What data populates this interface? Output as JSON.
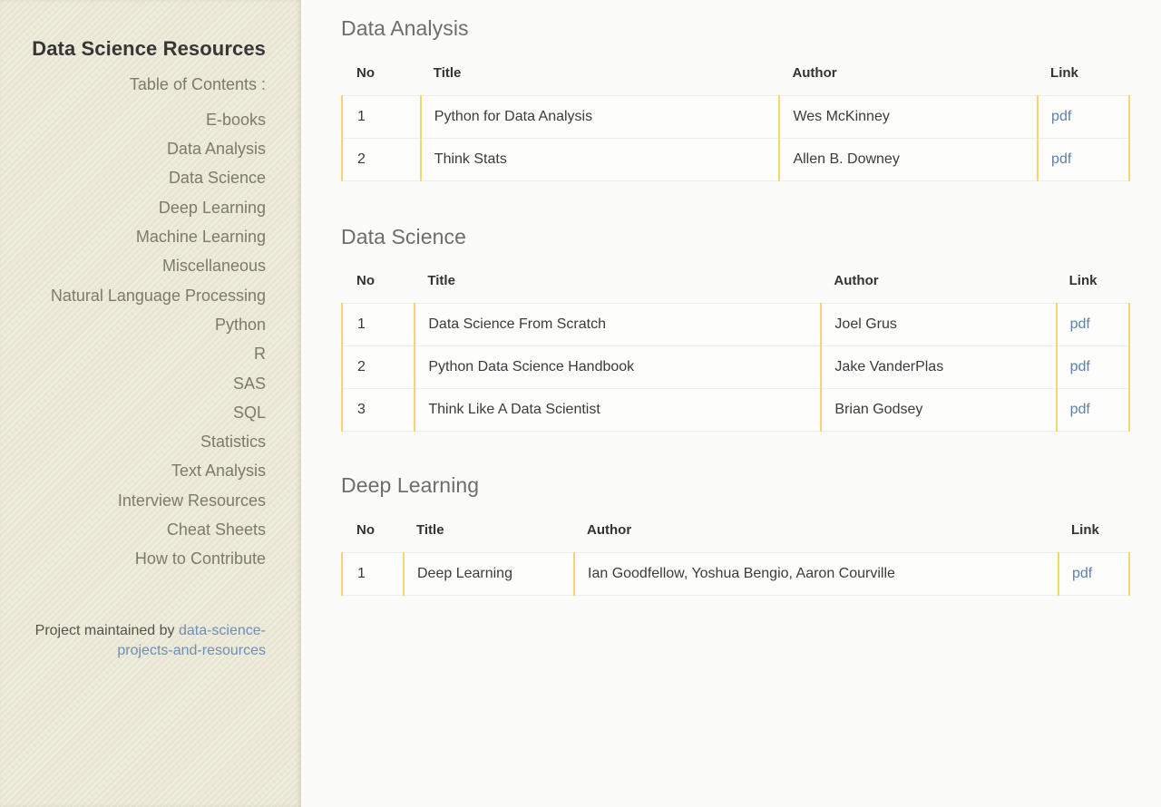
{
  "sidebar": {
    "title": "Data Science Resources",
    "toc_caption": "Table of Contents :",
    "items": [
      {
        "label": "E-books"
      },
      {
        "label": "Data Analysis"
      },
      {
        "label": "Data Science"
      },
      {
        "label": "Deep Learning"
      },
      {
        "label": "Machine Learning"
      },
      {
        "label": "Miscellaneous"
      },
      {
        "label": "Natural Language Processing"
      },
      {
        "label": "Python"
      },
      {
        "label": "R"
      },
      {
        "label": "SAS"
      },
      {
        "label": "SQL"
      },
      {
        "label": "Statistics"
      },
      {
        "label": "Text Analysis"
      },
      {
        "label": "Interview Resources"
      },
      {
        "label": "Cheat Sheets"
      },
      {
        "label": "How to Contribute"
      }
    ],
    "footer": {
      "prefix": "Project maintained by ",
      "link_label": "data-science-projects-and-resources"
    }
  },
  "colors": {
    "sidebar_bg": "#eae6d4",
    "content_bg": "#fbfbf9",
    "table_accent": "#f5d76e",
    "link": "#5b81ad",
    "heading": "#6d6d6d",
    "sidebar_text": "#7d7a6d"
  },
  "sections": [
    {
      "id": "data-analysis",
      "title": "Data Analysis",
      "columns": [
        "No",
        "Title",
        "Author",
        "Link"
      ],
      "rows": [
        {
          "no": "1",
          "title": "Python for Data Analysis",
          "author": "Wes McKinney",
          "link": "pdf"
        },
        {
          "no": "2",
          "title": "Think Stats",
          "author": "Allen B. Downey",
          "link": "pdf"
        }
      ]
    },
    {
      "id": "data-science",
      "title": "Data Science",
      "columns": [
        "No",
        "Title",
        "Author",
        "Link"
      ],
      "rows": [
        {
          "no": "1",
          "title": "Data Science From Scratch",
          "author": "Joel Grus",
          "link": "pdf"
        },
        {
          "no": "2",
          "title": "Python Data Science Handbook",
          "author": "Jake VanderPlas",
          "link": "pdf"
        },
        {
          "no": "3",
          "title": "Think Like A Data Scientist",
          "author": "Brian Godsey",
          "link": "pdf"
        }
      ]
    },
    {
      "id": "deep-learning",
      "title": "Deep Learning",
      "columns": [
        "No",
        "Title",
        "Author",
        "Link"
      ],
      "rows": [
        {
          "no": "1",
          "title": "Deep Learning",
          "author": "Ian Goodfellow, Yoshua Bengio, Aaron Courville",
          "link": "pdf"
        }
      ]
    }
  ]
}
